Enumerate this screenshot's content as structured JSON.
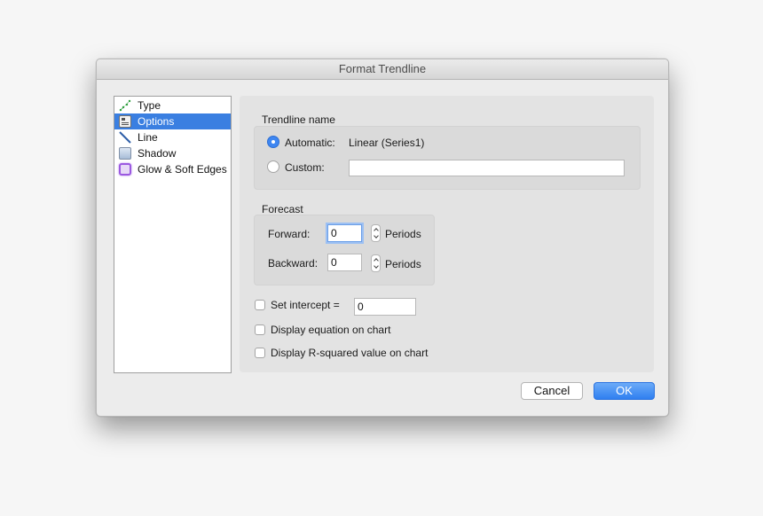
{
  "window": {
    "title": "Format Trendline"
  },
  "sidebar": {
    "items": [
      {
        "label": "Type",
        "icon": "trendline-icon",
        "selected": false
      },
      {
        "label": "Options",
        "icon": "options-icon",
        "selected": true
      },
      {
        "label": "Line",
        "icon": "line-icon",
        "selected": false
      },
      {
        "label": "Shadow",
        "icon": "shadow-icon",
        "selected": false
      },
      {
        "label": "Glow & Soft Edges",
        "icon": "glow-icon",
        "selected": false
      }
    ]
  },
  "trendline_name": {
    "heading": "Trendline name",
    "automatic_label": "Automatic:",
    "automatic_value": "Linear (Series1)",
    "automatic_selected": true,
    "custom_label": "Custom:",
    "custom_value": ""
  },
  "forecast": {
    "heading": "Forecast",
    "forward_label": "Forward:",
    "forward_value": "0",
    "backward_label": "Backward:",
    "backward_value": "0",
    "unit": "Periods"
  },
  "options": {
    "set_intercept_label": "Set intercept =",
    "set_intercept_checked": false,
    "intercept_value": "0",
    "display_equation_label": "Display equation on chart",
    "display_equation_checked": false,
    "display_rsquared_label": "Display R-squared value on chart",
    "display_rsquared_checked": false
  },
  "buttons": {
    "cancel": "Cancel",
    "ok": "OK"
  },
  "colors": {
    "accent": "#3a7fe1",
    "ok_button": "#3e86f1",
    "panel": "#e3e3e3"
  }
}
